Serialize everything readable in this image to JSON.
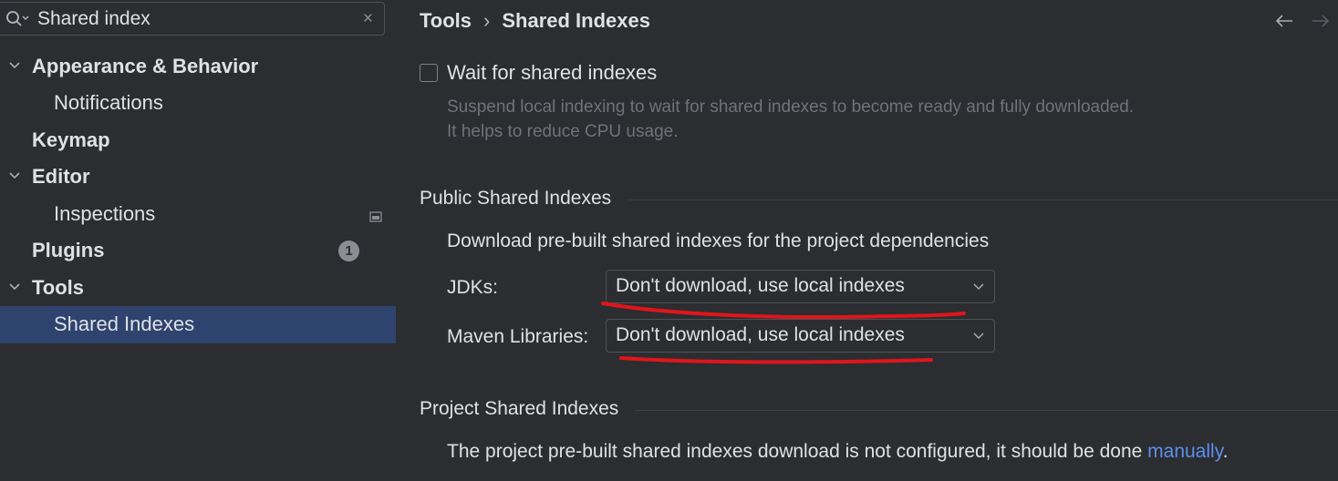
{
  "search": {
    "value": "Shared index",
    "clear_glyph": "×"
  },
  "sidebar": {
    "items": [
      {
        "label": "Appearance & Behavior",
        "expanded": true
      },
      {
        "label": "Notifications"
      },
      {
        "label": "Keymap"
      },
      {
        "label": "Editor",
        "expanded": true
      },
      {
        "label": "Inspections"
      },
      {
        "label": "Plugins",
        "badge": "1"
      },
      {
        "label": "Tools",
        "expanded": true
      },
      {
        "label": "Shared Indexes",
        "selected": true
      }
    ]
  },
  "header": {
    "breadcrumb": [
      "Tools",
      "Shared Indexes"
    ],
    "separator": "›"
  },
  "wait_option": {
    "label": "Wait for shared indexes",
    "checked": false,
    "description": "Suspend local indexing to wait for shared indexes to become ready and fully downloaded. It helps to reduce CPU usage."
  },
  "public_section": {
    "title": "Public Shared Indexes",
    "description": "Download pre-built shared indexes for the project dependencies",
    "jdks": {
      "label": "JDKs:",
      "value": "Don't download, use local indexes"
    },
    "maven": {
      "label": "Maven Libraries:",
      "value": "Don't download, use local indexes"
    }
  },
  "project_section": {
    "title": "Project Shared Indexes",
    "text": "The project pre-built shared indexes download is not configured, it should be done ",
    "link": "manually",
    "suffix": "."
  },
  "colors": {
    "background": "#2b2d30",
    "selection": "#2e436e",
    "link": "#5d8ef0",
    "annotation": "#e0151b"
  }
}
